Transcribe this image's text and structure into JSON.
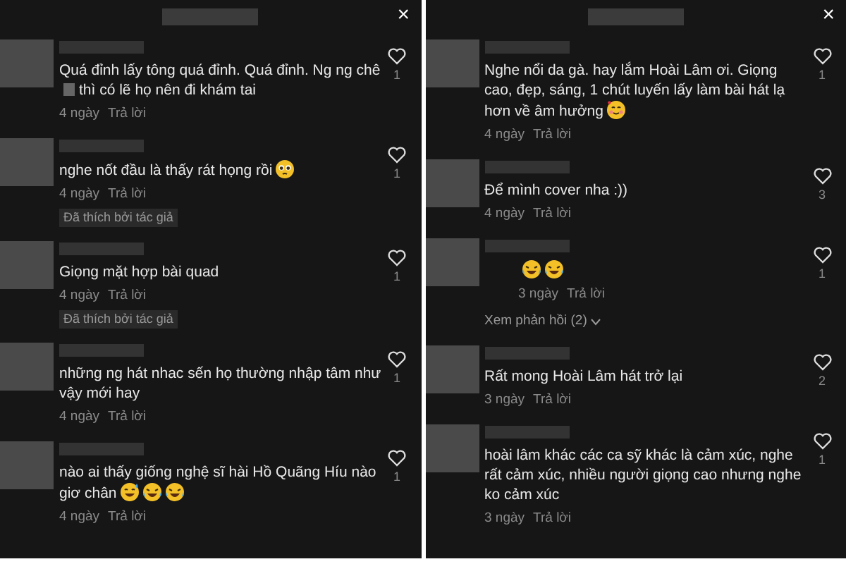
{
  "panels": [
    {
      "close": "×",
      "comments": [
        {
          "kind": "text",
          "text": "Quá đỉnh lấy tông quá đỉnh. Quá đỉnh. Ng ng chê",
          "text_after": "thì có lẽ họ nên đi khám tai",
          "time": "4 ngày",
          "reply": "Trả lời",
          "likes": "1"
        },
        {
          "kind": "text",
          "text": "nghe nốt đầu là thấy rát họng rồi",
          "emojis": [
            {
              "kind": "pleading"
            }
          ],
          "time": "4 ngày",
          "reply": "Trả lời",
          "badge": "Đã thích bởi tác giả",
          "likes": "1"
        },
        {
          "kind": "text",
          "text": "Giọng mặt hợp bài quad",
          "time": "4 ngày",
          "reply": "Trả lời",
          "badge": "Đã thích bởi tác giả",
          "likes": "1"
        },
        {
          "kind": "text",
          "text": "những ng hát nhac sến họ thường nhập tâm như vậy mới hay",
          "time": "4 ngày",
          "reply": "Trả lời",
          "likes": "1"
        },
        {
          "kind": "text",
          "text": "nào ai thấy giống nghệ sĩ hài Hồ Quãng Híu nào giơ chân",
          "emojis": [
            {
              "kind": "sweat"
            },
            {
              "kind": "laugh"
            },
            {
              "kind": "laugh"
            }
          ],
          "time": "4 ngày",
          "reply": "Trả lời",
          "likes": "1"
        }
      ]
    },
    {
      "close": "×",
      "comments": [
        {
          "kind": "text",
          "text": "Nghe nổi da gà. hay lắm Hoài Lâm ơi. Giọng cao, đẹp, sáng, 1 chút luyến lấy làm bài hát lạ hơn về âm hưởng",
          "emojis": [
            {
              "kind": "hearts"
            }
          ],
          "time": "4 ngày",
          "reply": "Trả lời",
          "likes": "1"
        },
        {
          "kind": "text",
          "text": "Để mình cover nha :))",
          "time": "4 ngày",
          "reply": "Trả lời",
          "likes": "3"
        },
        {
          "kind": "emoji_only",
          "emojis": [
            {
              "kind": "laugh"
            },
            {
              "kind": "laugh"
            }
          ],
          "time": "3 ngày",
          "reply": "Trả lời",
          "likes": "1",
          "view_replies": "Xem phản hồi (2)"
        },
        {
          "kind": "text",
          "text": "Rất mong Hoài Lâm hát trở lại",
          "time": "3 ngày",
          "reply": "Trả lời",
          "likes": "2"
        },
        {
          "kind": "text",
          "text": "hoài lâm khác các ca sỹ khác là cảm xúc, nghe rất cảm xúc, nhiều người giọng cao nhưng nghe ko cảm xúc",
          "time": "3 ngày",
          "reply": "Trả lời",
          "likes": "1"
        }
      ]
    }
  ]
}
